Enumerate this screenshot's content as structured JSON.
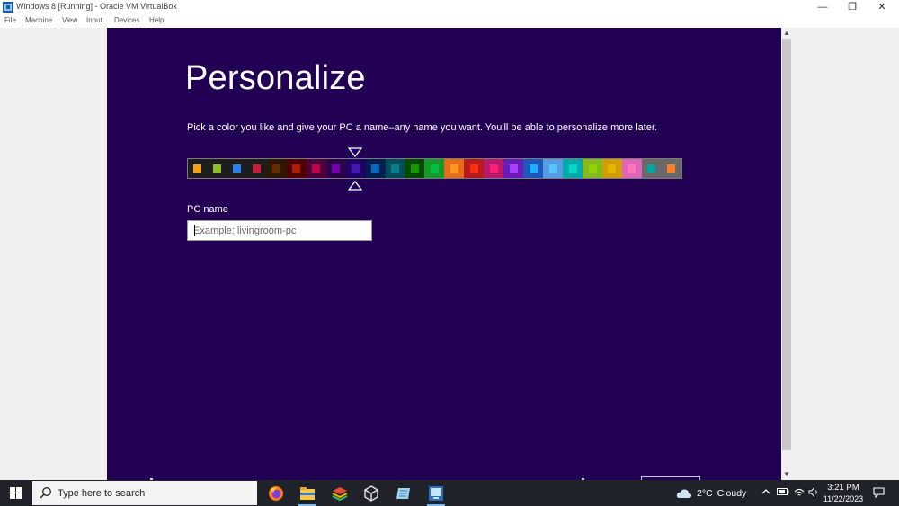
{
  "window": {
    "title": "Windows 8 [Running] - Oracle VM VirtualBox",
    "minimize_glyph": "—",
    "restore_glyph": "❐",
    "close_glyph": "✕"
  },
  "menubar": {
    "items": [
      "File",
      "Machine",
      "View",
      "Input",
      "Devices",
      "Help"
    ]
  },
  "vm": {
    "heading": "Personalize",
    "instruction": "Pick a color you like and give your PC a name–any name you want. You'll be able to personalize more later.",
    "palette": {
      "selected_index": 8,
      "swatches": [
        {
          "bg": "#1d1d1d",
          "fg": "#f0a30a"
        },
        {
          "bg": "#1d1d1d",
          "fg": "#8cbf26"
        },
        {
          "bg": "#1d1d1d",
          "fg": "#2d7ff0"
        },
        {
          "bg": "#1d1d1d",
          "fg": "#c71e3a"
        },
        {
          "bg": "#2e1700",
          "fg": "#632f00"
        },
        {
          "bg": "#4e0000",
          "fg": "#b01e00"
        },
        {
          "bg": "#4e0038",
          "fg": "#c1004f"
        },
        {
          "bg": "#2d004e",
          "fg": "#7200ac"
        },
        {
          "bg": "#1f0068",
          "fg": "#4617b4"
        },
        {
          "bg": "#001e4e",
          "fg": "#006ac1"
        },
        {
          "bg": "#004d60",
          "fg": "#008287"
        },
        {
          "bg": "#004a00",
          "fg": "#199900"
        },
        {
          "bg": "#15992a",
          "fg": "#00c13f"
        },
        {
          "bg": "#e56c19",
          "fg": "#ff981d"
        },
        {
          "bg": "#b81b1b",
          "fg": "#ff2e12"
        },
        {
          "bg": "#b81b6c",
          "fg": "#ff1d77"
        },
        {
          "bg": "#691bb8",
          "fg": "#aa40ff"
        },
        {
          "bg": "#1b58b8",
          "fg": "#1faeff"
        },
        {
          "bg": "#569ce3",
          "fg": "#56c5ff"
        },
        {
          "bg": "#00aaaa",
          "fg": "#00d8cc"
        },
        {
          "bg": "#83ba1f",
          "fg": "#91d100"
        },
        {
          "bg": "#d39d09",
          "fg": "#e1b700"
        },
        {
          "bg": "#e064b7",
          "fg": "#ff76bc"
        },
        {
          "bg": "#696969",
          "fg": "#00a4a4"
        },
        {
          "bg": "#696969",
          "fg": "#ff7d23"
        }
      ]
    },
    "pc_name_label": "PC name",
    "pc_name_placeholder": "Example: livingroom-pc",
    "pc_name_value": ""
  },
  "taskbar": {
    "search_placeholder": "Type here to search",
    "apps": [
      "firefox-icon",
      "file-explorer-icon",
      "stack-app-icon",
      "virtualbox-cube-icon",
      "notepad-icon",
      "virtualbox-vm-icon"
    ],
    "weather": {
      "temp": "2°C",
      "condition": "Cloudy"
    },
    "time": "3:21 PM",
    "date": "11/22/2023"
  },
  "colors": {
    "vm_background": "#220054",
    "taskbar": "#1f2329",
    "accent": "#76b9ed"
  }
}
